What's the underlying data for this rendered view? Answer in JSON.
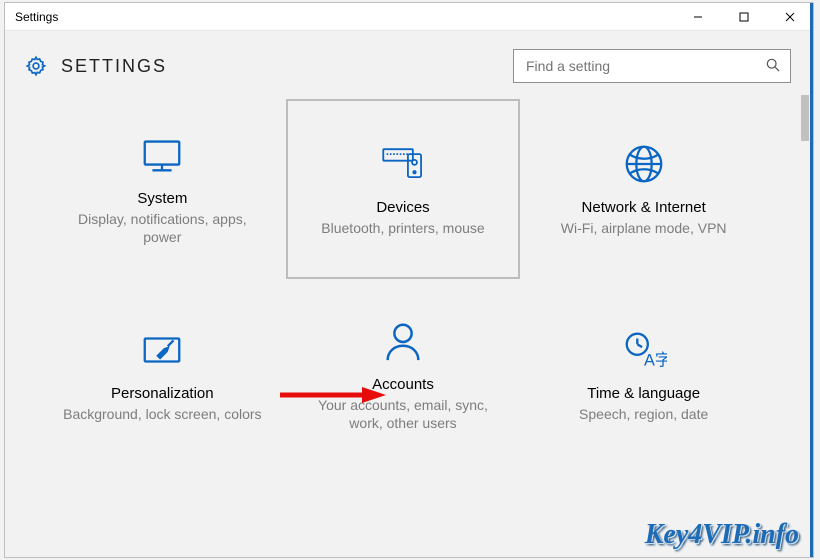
{
  "window": {
    "title": "Settings"
  },
  "header": {
    "title": "SETTINGS"
  },
  "search": {
    "placeholder": "Find a setting",
    "value": ""
  },
  "tiles": [
    {
      "icon": "display-icon",
      "title": "System",
      "desc": "Display, notifications, apps, power"
    },
    {
      "icon": "devices-icon",
      "title": "Devices",
      "desc": "Bluetooth, printers, mouse"
    },
    {
      "icon": "globe-icon",
      "title": "Network & Internet",
      "desc": "Wi-Fi, airplane mode, VPN"
    },
    {
      "icon": "personalization-icon",
      "title": "Personalization",
      "desc": "Background, lock screen, colors"
    },
    {
      "icon": "accounts-icon",
      "title": "Accounts",
      "desc": "Your accounts, email, sync, work, other users"
    },
    {
      "icon": "time-language-icon",
      "title": "Time & language",
      "desc": "Speech, region, date"
    }
  ],
  "watermark": "Key4VIP.info",
  "accent": "#0a66c2",
  "annotation": {
    "arrow_target": "accounts-tile"
  }
}
